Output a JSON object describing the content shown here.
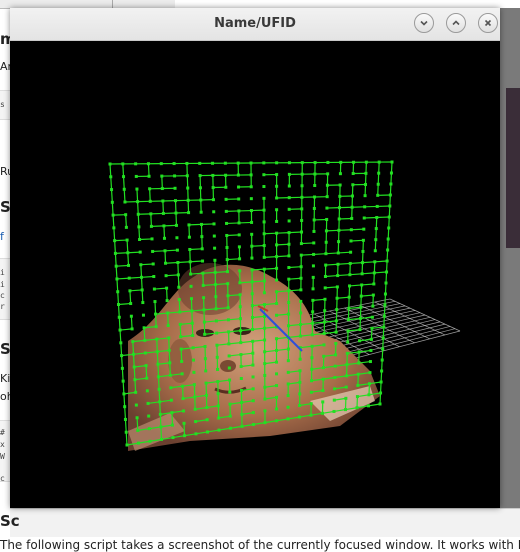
{
  "window": {
    "title": "Name/UFID",
    "buttons": [
      {
        "name": "minimize",
        "icon": "chevron-down-icon"
      },
      {
        "name": "maximize",
        "icon": "chevron-up-icon"
      },
      {
        "name": "close",
        "icon": "close-icon"
      }
    ]
  },
  "background_document": {
    "fragments": [
      "m",
      "An",
      "s",
      "Ru",
      "So",
      "f",
      "i",
      "i",
      "c",
      "r",
      "Sc",
      "Kin",
      "oh",
      "#",
      "x",
      "W",
      "c",
      "Sc"
    ],
    "bottom_text": "The following script takes a screenshot of the currently focused window. It works with Fvw"
  },
  "scene": {
    "background_color": "#000000",
    "mesh_color": "#22e022",
    "ground_grid_color": "#cfcfcf",
    "axis_color": "#2f4fd8",
    "face_texture_colors": [
      "#a86d4a",
      "#6b4030",
      "#d2a17c"
    ]
  }
}
